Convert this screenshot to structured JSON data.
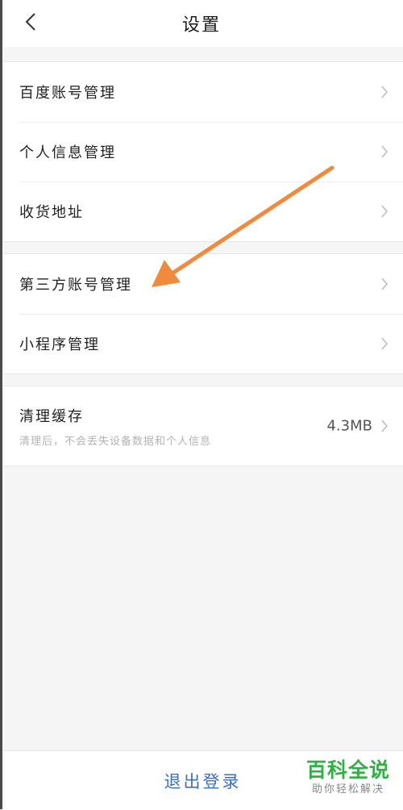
{
  "header": {
    "title": "设置",
    "back_icon": "chevron-left-icon"
  },
  "group_account": {
    "items": [
      {
        "label": "百度账号管理"
      },
      {
        "label": "个人信息管理"
      },
      {
        "label": "收货地址"
      }
    ]
  },
  "group_third": {
    "items": [
      {
        "label": "第三方账号管理"
      },
      {
        "label": "小程序管理"
      }
    ]
  },
  "cache": {
    "title": "清理缓存",
    "subtitle": "清理后，不会丢失设备数据和个人信息",
    "size": "4.3MB"
  },
  "footer": {
    "logout_label": "退出登录"
  },
  "watermark": {
    "main": "百科全说",
    "sub": "助你轻松解决"
  },
  "colors": {
    "accent": "#3b6fc4",
    "annotation_arrow": "#f08a3c",
    "watermark": "#2fb143"
  }
}
